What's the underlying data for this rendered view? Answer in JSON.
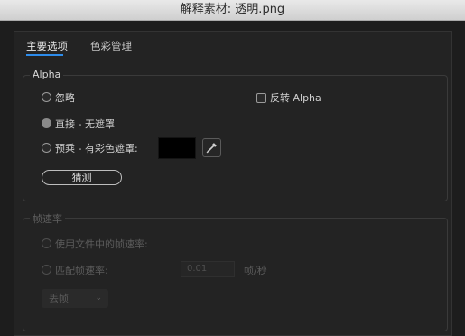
{
  "window": {
    "title": "解释素材: 透明.png"
  },
  "tabs": [
    {
      "label": "主要选项",
      "active": true
    },
    {
      "label": "色彩管理",
      "active": false
    }
  ],
  "alpha_group": {
    "legend": "Alpha",
    "ignore_label": "忽略",
    "invert_label": "反转 Alpha",
    "straight_label": "直接 - 无遮罩",
    "premultiplied_label": "预乘 - 有彩色遮罩:",
    "matte_color": "#000000",
    "guess_button": "猜测",
    "selected": "直接 - 无遮罩"
  },
  "frame_rate_group": {
    "legend": "帧速率",
    "use_file_label": "使用文件中的帧速率:",
    "assume_label": "匹配帧速率:",
    "assume_value": "0.01",
    "unit": "帧/秒",
    "dropdown_value": "丢帧"
  },
  "icons": {
    "eyedropper": "eyedropper-icon",
    "chevron": "chevron-down-icon"
  },
  "colors": {
    "accent": "#2d8ceb",
    "background": "#1d1d1d"
  }
}
